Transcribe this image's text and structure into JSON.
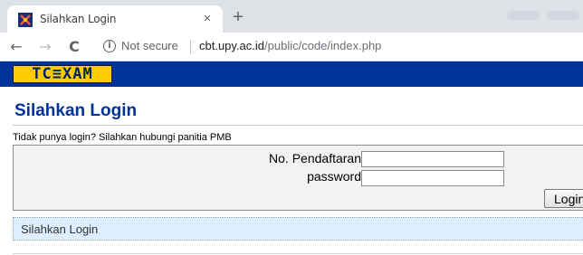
{
  "browser": {
    "tab": {
      "title": "Silahkan Login",
      "close_glyph": "×",
      "favicon": "tcexam-favicon"
    },
    "new_tab_glyph": "+",
    "nav": {
      "back_glyph": "←",
      "forward_glyph": "→",
      "reload_glyph": "C",
      "info_glyph": "i"
    },
    "omnibox": {
      "security_label": "Not secure",
      "url_host": "cbt.upy.ac.id",
      "url_path": "/public/code/index.php"
    }
  },
  "header": {
    "logo_text": "TC≡XAM",
    "logo_colors": {
      "background": "#ffcc00",
      "text": "#002266"
    },
    "bar_color": "#003399"
  },
  "page": {
    "title": "Silahkan Login",
    "hint": "Tidak punya login? Silahkan hubungi panitia PMB",
    "form": {
      "registration_label": "No. Pendaftaran",
      "registration_value": "",
      "password_label": "password",
      "password_value": "",
      "submit_label": "Login"
    },
    "status_message": "Silahkan Login"
  }
}
